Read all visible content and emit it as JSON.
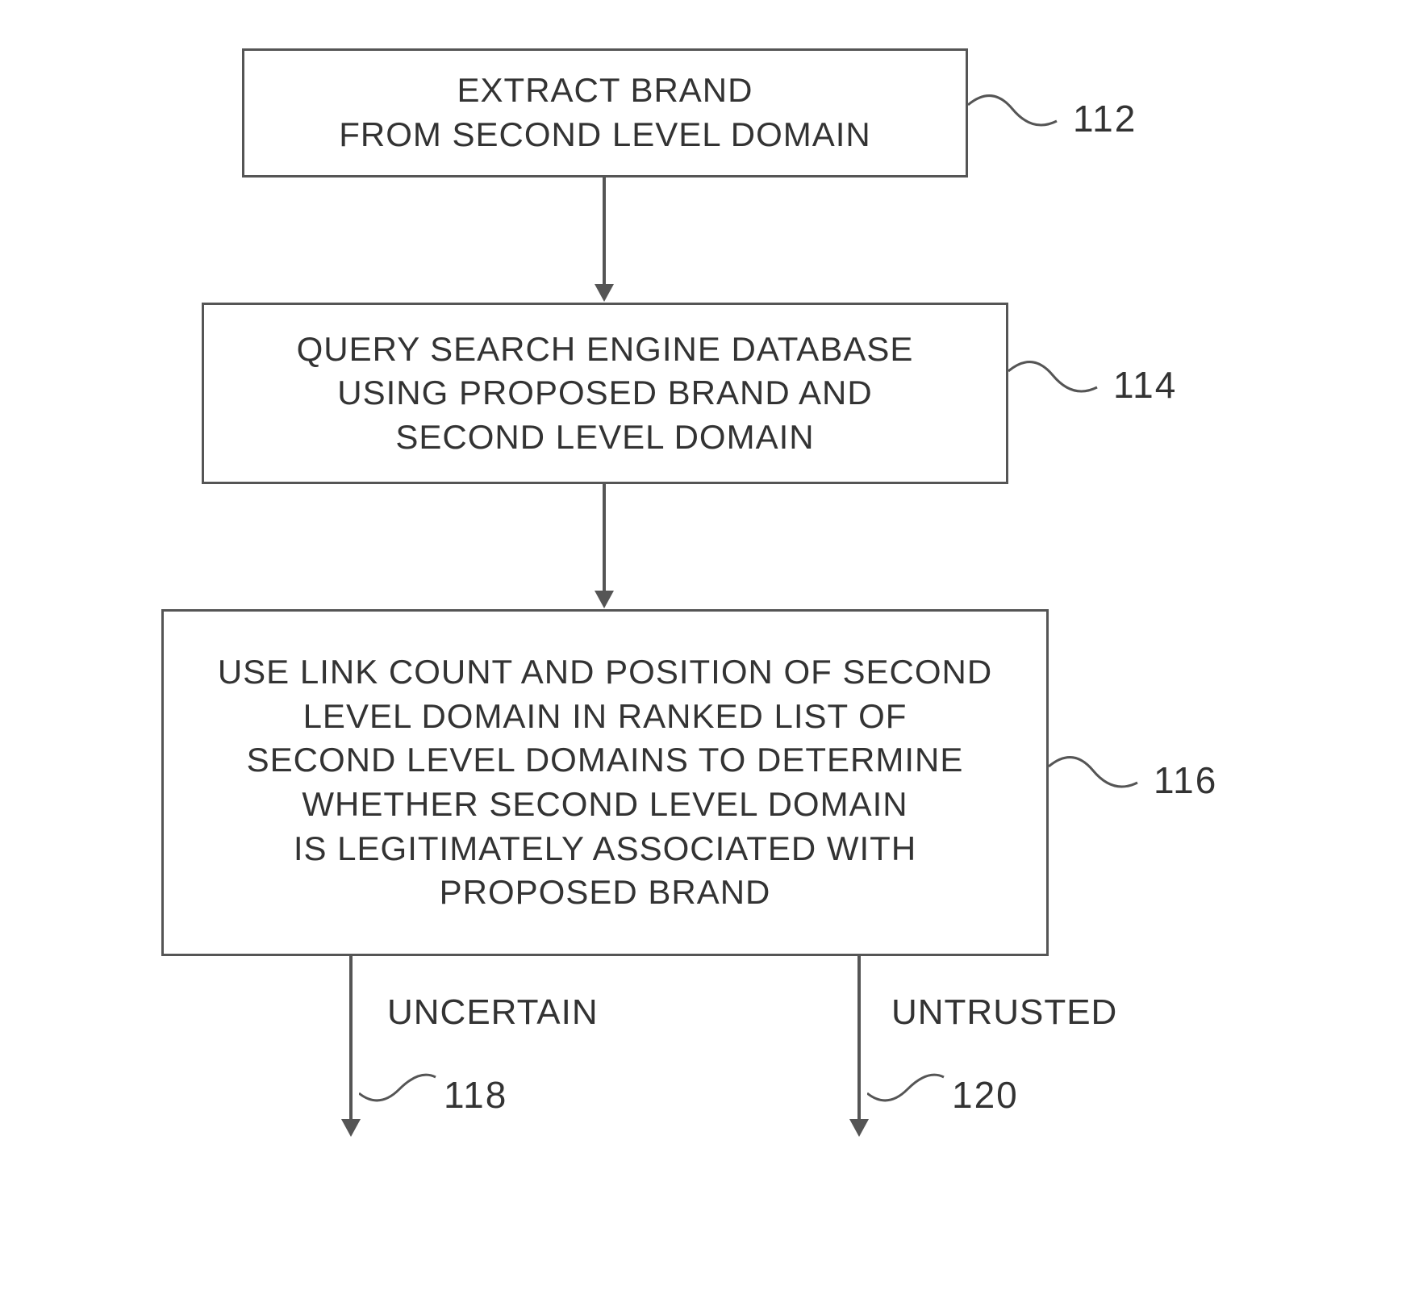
{
  "chart_data": {
    "type": "flowchart",
    "nodes": [
      {
        "id": "112",
        "label": "EXTRACT BRAND\nFROM SECOND LEVEL DOMAIN"
      },
      {
        "id": "114",
        "label": "QUERY SEARCH ENGINE DATABASE\nUSING PROPOSED BRAND AND\nSECOND LEVEL DOMAIN"
      },
      {
        "id": "116",
        "label": "USE LINK COUNT AND POSITION OF SECOND\nLEVEL DOMAIN IN RANKED LIST OF\nSECOND LEVEL DOMAINS TO DETERMINE\nWHETHER SECOND LEVEL DOMAIN\nIS LEGITIMATELY ASSOCIATED WITH\nPROPOSED BRAND"
      }
    ],
    "edges": [
      {
        "from": "112",
        "to": "114"
      },
      {
        "from": "114",
        "to": "116"
      },
      {
        "from": "116",
        "to": "118",
        "label": "UNCERTAIN"
      },
      {
        "from": "116",
        "to": "120",
        "label": "UNTRUSTED"
      }
    ],
    "outputs": [
      {
        "id": "118",
        "label": "UNCERTAIN"
      },
      {
        "id": "120",
        "label": "UNTRUSTED"
      }
    ]
  },
  "boxes": {
    "b112": "EXTRACT BRAND\nFROM SECOND LEVEL DOMAIN",
    "b114": "QUERY SEARCH ENGINE DATABASE\nUSING PROPOSED BRAND AND\nSECOND LEVEL DOMAIN",
    "b116": "USE LINK COUNT AND POSITION OF SECOND\nLEVEL DOMAIN IN RANKED LIST OF\nSECOND LEVEL DOMAINS TO DETERMINE\nWHETHER SECOND LEVEL DOMAIN\nIS LEGITIMATELY ASSOCIATED WITH\nPROPOSED BRAND"
  },
  "refs": {
    "r112": "112",
    "r114": "114",
    "r116": "116",
    "r118": "118",
    "r120": "120"
  },
  "outputs": {
    "uncertain": "UNCERTAIN",
    "untrusted": "UNTRUSTED"
  }
}
